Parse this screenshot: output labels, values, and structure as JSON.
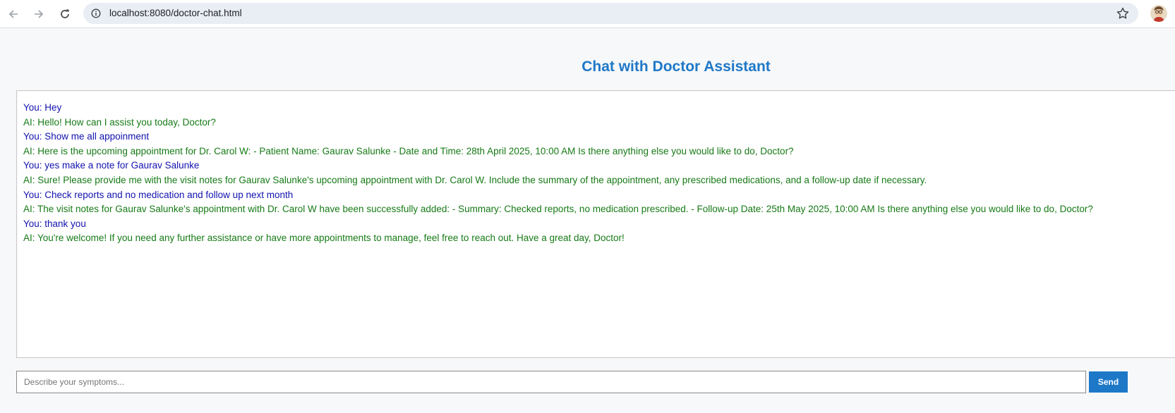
{
  "browser": {
    "url": "localhost:8080/doctor-chat.html",
    "icons": {
      "back": "back-arrow-icon",
      "forward": "forward-arrow-icon",
      "reload": "reload-icon",
      "site_info": "info-icon",
      "bookmark": "star-icon",
      "profile": "profile-avatar"
    }
  },
  "page": {
    "title": "Chat with Doctor Assistant"
  },
  "chat": {
    "messages": [
      {
        "sender": "user",
        "text": "You: Hey"
      },
      {
        "sender": "ai",
        "text": "AI: Hello! How can I assist you today, Doctor?"
      },
      {
        "sender": "user",
        "text": "You: Show me all appoinment"
      },
      {
        "sender": "ai",
        "text": "AI: Here is the upcoming appointment for Dr. Carol W: - Patient Name: Gaurav Salunke - Date and Time: 28th April 2025, 10:00 AM Is there anything else you would like to do, Doctor?"
      },
      {
        "sender": "user",
        "text": "You: yes make a note for Gaurav Salunke"
      },
      {
        "sender": "ai",
        "text": "AI: Sure! Please provide me with the visit notes for Gaurav Salunke's upcoming appointment with Dr. Carol W. Include the summary of the appointment, any prescribed medications, and a follow-up date if necessary."
      },
      {
        "sender": "user",
        "text": "You: Check reports and no medication and follow up next month"
      },
      {
        "sender": "ai",
        "text": "AI: The visit notes for Gaurav Salunke's appointment with Dr. Carol W have been successfully added: - Summary: Checked reports, no medication prescribed. - Follow-up Date: 25th May 2025, 10:00 AM Is there anything else you would like to do, Doctor?"
      },
      {
        "sender": "user",
        "text": "You: thank you"
      },
      {
        "sender": "ai",
        "text": "AI: You're welcome! If you need any further assistance or have more appointments to manage, feel free to reach out. Have a great day, Doctor!"
      }
    ]
  },
  "input": {
    "value": "",
    "placeholder": "Describe your symptoms...",
    "send_label": "Send"
  },
  "colors": {
    "accent": "#1e78c8",
    "user_text": "#1212b0",
    "ai_text": "#167a16",
    "page_bg": "#f7f8f9"
  }
}
